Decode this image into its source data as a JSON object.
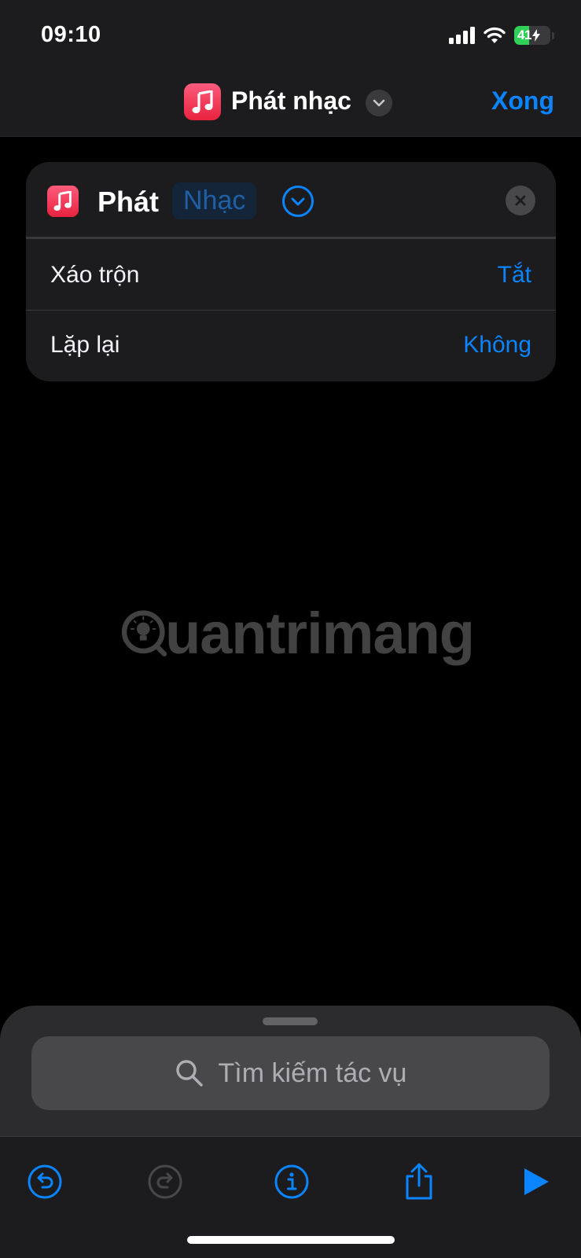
{
  "status_bar": {
    "time": "09:10",
    "battery_level": "41"
  },
  "nav": {
    "title": "Phát nhạc",
    "done_label": "Xong"
  },
  "action_card": {
    "verb": "Phát",
    "parameter": "Nhạc",
    "rows": [
      {
        "label": "Xáo trộn",
        "value": "Tắt"
      },
      {
        "label": "Lặp lại",
        "value": "Không"
      }
    ]
  },
  "watermark": {
    "text": "uantrimang"
  },
  "search": {
    "placeholder": "Tìm kiếm tác vụ"
  },
  "toolbar": {
    "icons": [
      "undo-icon",
      "redo-icon",
      "info-icon",
      "share-icon",
      "play-icon"
    ]
  },
  "colors": {
    "accent": "#0a84ff",
    "battery": "#30d158",
    "music_app": "#fa2d48"
  }
}
